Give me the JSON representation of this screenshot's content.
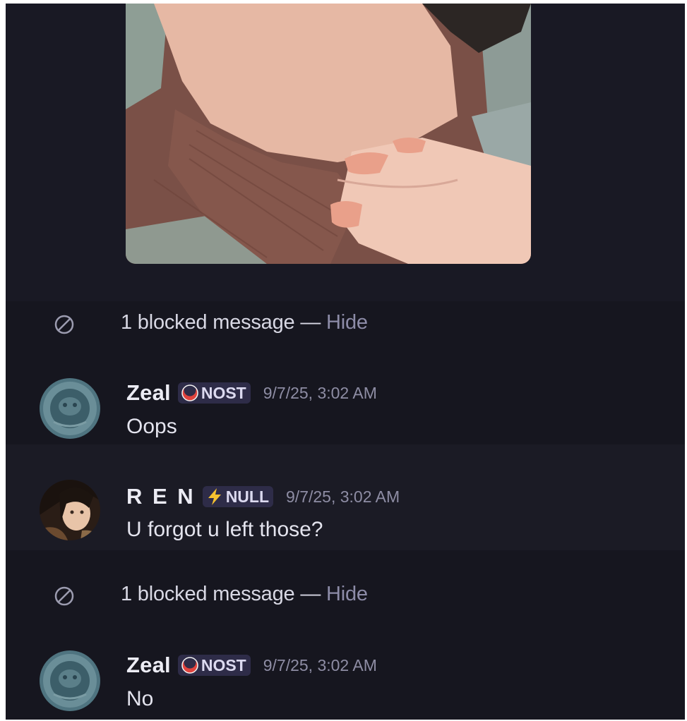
{
  "blocked_notice": {
    "label": "1 blocked message — ",
    "hide_label": "Hide"
  },
  "messages": [
    {
      "username": "Zeal",
      "tag": "NOST",
      "tag_icon": "red-crescent-icon",
      "timestamp": "9/7/25, 3:02 AM",
      "text": "Oops",
      "avatar": "avatar-zeal"
    },
    {
      "username": "R E N",
      "tag": "NULL",
      "tag_icon": "lightning-bolt-icon",
      "timestamp": "9/7/25, 3:02 AM",
      "text": "U forgot u left those?",
      "avatar": "avatar-ren"
    },
    {
      "username": "Zeal",
      "tag": "NOST",
      "tag_icon": "red-crescent-icon",
      "timestamp": "9/7/25, 3:02 AM",
      "text": "No",
      "avatar": "avatar-zeal"
    }
  ],
  "colors": {
    "background": "#16161f",
    "highlight_row": "#1b1b25",
    "hide_link": "#8d8ca8",
    "tag_background": "#2e2c48",
    "timestamp": "#8e8da4"
  }
}
